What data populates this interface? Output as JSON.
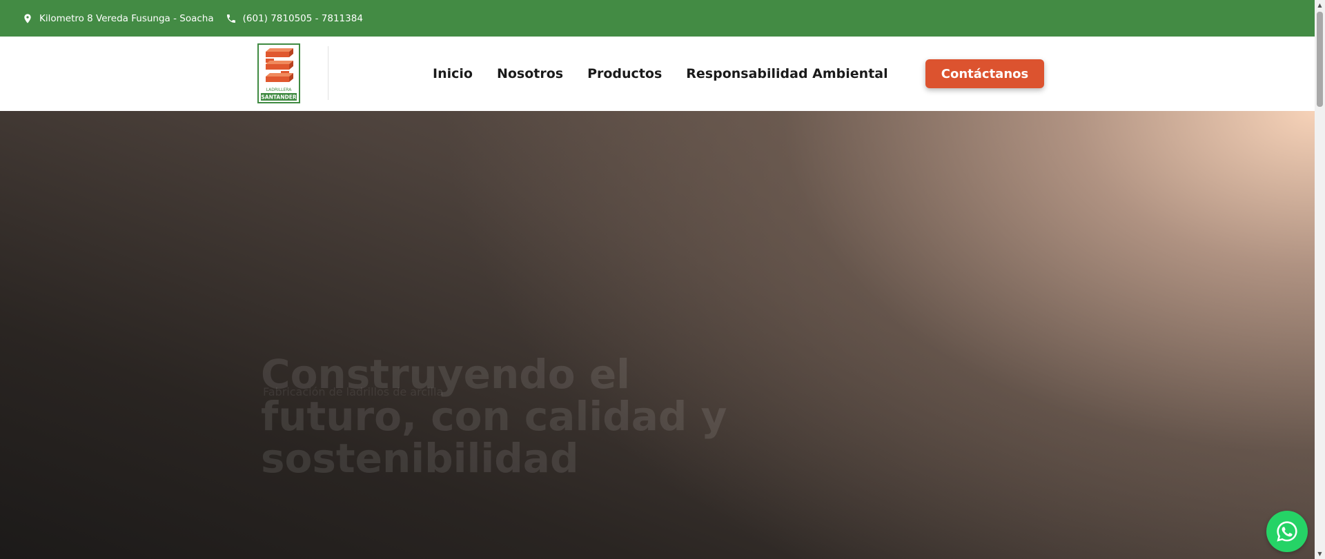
{
  "topbar": {
    "address": "Kilometro 8 Vereda Fusunga - Soacha",
    "address_icon": "location-pin-icon",
    "phone": "(601) 7810505 - 7811384",
    "phone_icon": "phone-icon",
    "background": "#438b44"
  },
  "header": {
    "logo": {
      "line1": "LADRILLERA",
      "line2": "SANTANDER",
      "brand_green": "#3f8a41",
      "brand_orange": "#e0582f"
    },
    "nav": [
      {
        "label": "Inicio"
      },
      {
        "label": "Nosotros"
      },
      {
        "label": "Productos"
      },
      {
        "label": "Responsabilidad Ambiental"
      }
    ],
    "cta_label": "Contáctanos",
    "cta_color": "#dc532f"
  },
  "hero": {
    "subtitle": "Fabricación de ladrillos de arcilla",
    "title": "Construyendo el futuro, con calidad y sostenibilidad"
  },
  "whatsapp": {
    "icon": "whatsapp-icon",
    "color": "#25d366"
  }
}
